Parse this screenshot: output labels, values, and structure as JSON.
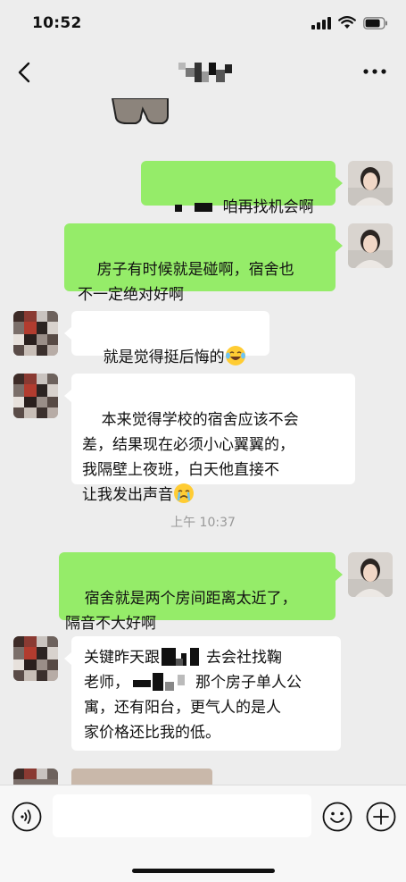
{
  "status_bar": {
    "time": "10:52"
  },
  "nav": {
    "title": ""
  },
  "messages": [
    {
      "from": "me",
      "text": "咱再找机会啊"
    },
    {
      "from": "me",
      "text": "房子有时候就是碰啊，宿舍也\n不一定绝对好啊"
    },
    {
      "from": "them",
      "text": "就是觉得挺后悔的",
      "emoji": "laughing-crying-emoji"
    },
    {
      "from": "them",
      "text": "本来觉得学校的宿舍应该不会\n差，结果现在必须小心翼翼的，\n我隔壁上夜班，白天他直接不\n让我发出声音",
      "emoji": "crying-emoji"
    },
    {
      "type": "timestamp",
      "text": "上午 10:37"
    },
    {
      "from": "me",
      "text": "宿舍就是两个房间距离太近了，\n隔音不大好啊"
    },
    {
      "from": "them",
      "lines": [
        "关键昨天跟",
        "去会社找鞠",
        "老师，",
        "那个房子单人公",
        "寓，还有阳台，更气人的是人",
        "家价格还比我的低。"
      ]
    }
  ],
  "input": {
    "placeholder": ""
  },
  "colors": {
    "my_bubble": "#95ec69",
    "their_bubble": "#ffffff",
    "background": "#ededed"
  }
}
